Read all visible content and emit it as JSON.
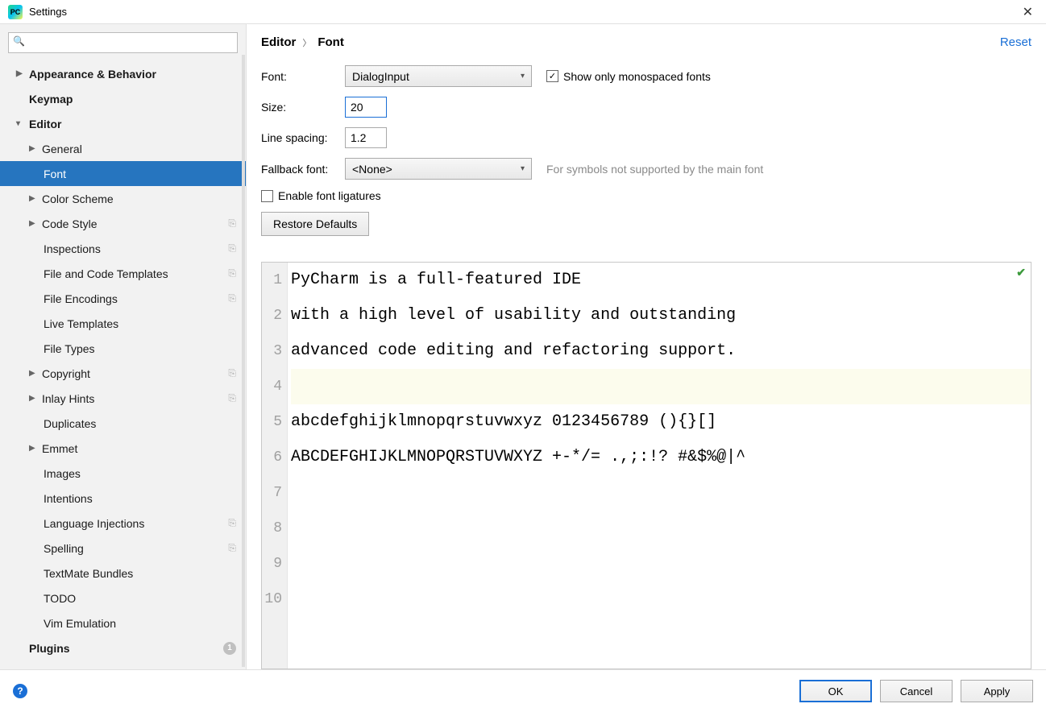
{
  "window": {
    "title": "Settings"
  },
  "sidebar": {
    "search_placeholder": "",
    "items": {
      "appearance": "Appearance & Behavior",
      "keymap": "Keymap",
      "editor": "Editor",
      "general": "General",
      "font": "Font",
      "color_scheme": "Color Scheme",
      "code_style": "Code Style",
      "inspections": "Inspections",
      "file_code_templates": "File and Code Templates",
      "file_encodings": "File Encodings",
      "live_templates": "Live Templates",
      "file_types": "File Types",
      "copyright": "Copyright",
      "inlay_hints": "Inlay Hints",
      "duplicates": "Duplicates",
      "emmet": "Emmet",
      "images": "Images",
      "intentions": "Intentions",
      "language_injections": "Language Injections",
      "spelling": "Spelling",
      "textmate": "TextMate Bundles",
      "todo": "TODO",
      "vim": "Vim Emulation",
      "plugins": "Plugins"
    },
    "plugins_badge": "1"
  },
  "breadcrumb": {
    "root": "Editor",
    "leaf": "Font"
  },
  "actions": {
    "reset": "Reset"
  },
  "form": {
    "font_label": "Font:",
    "font_value": "DialogInput",
    "show_mono_label": "Show only monospaced fonts",
    "show_mono_checked": true,
    "size_label": "Size:",
    "size_value": "20",
    "line_spacing_label": "Line spacing:",
    "line_spacing_value": "1.2",
    "fallback_label": "Fallback font:",
    "fallback_value": "<None>",
    "fallback_hint": "For symbols not supported by the main font",
    "ligatures_label": "Enable font ligatures",
    "ligatures_checked": false,
    "restore_defaults": "Restore Defaults"
  },
  "preview": {
    "lines": [
      "PyCharm is a full-featured IDE",
      "with a high level of usability and outstanding",
      "advanced code editing and refactoring support.",
      "",
      "abcdefghijklmnopqrstuvwxyz 0123456789 (){}[]",
      "ABCDEFGHIJKLMNOPQRSTUVWXYZ +-*/= .,;:!? #&$%@|^",
      "",
      "",
      "",
      ""
    ],
    "line_numbers": [
      "1",
      "2",
      "3",
      "4",
      "5",
      "6",
      "7",
      "8",
      "9",
      "10"
    ],
    "cursor_line_index": 3
  },
  "buttons": {
    "ok": "OK",
    "cancel": "Cancel",
    "apply": "Apply"
  }
}
